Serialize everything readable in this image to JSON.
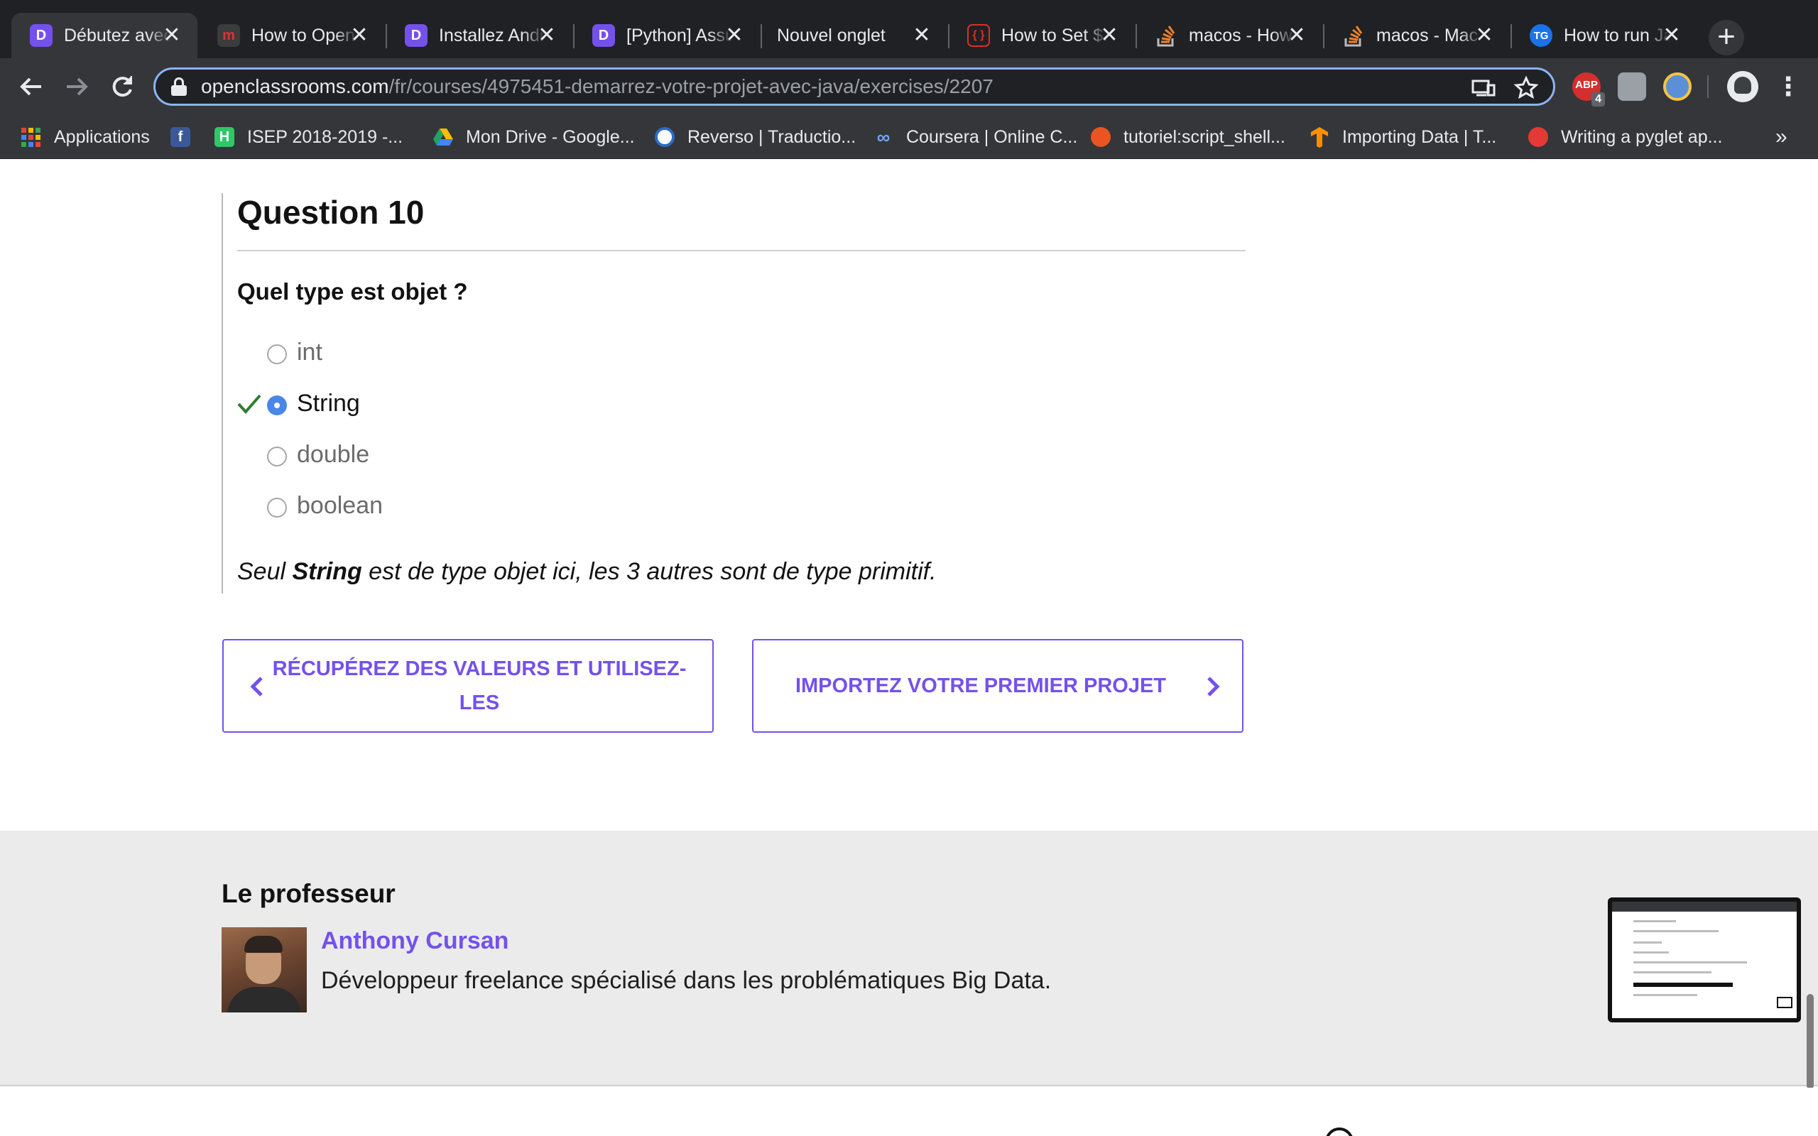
{
  "browser": {
    "tabs": [
      {
        "title": "Débutez avec Java",
        "favicon": "openclassrooms-icon",
        "favicon_color": "#7451eb",
        "active": true
      },
      {
        "title": "How to Open Terminal",
        "favicon": "m-icon",
        "favicon_color": "#d13639",
        "active": false
      },
      {
        "title": "Installez Android Studio",
        "favicon": "openclassrooms-icon",
        "favicon_color": "#7451eb",
        "active": false
      },
      {
        "title": "[Python] Assurez-vous",
        "favicon": "openclassrooms-icon",
        "favicon_color": "#7451eb",
        "active": false
      },
      {
        "title": "Nouvel onglet",
        "favicon": "",
        "favicon_color": "",
        "active": false
      },
      {
        "title": "How to Set $JAVA_HOME",
        "favicon": "code-brackets-icon",
        "favicon_color": "#d93025",
        "active": false
      },
      {
        "title": "macos - How to",
        "favicon": "stackoverflow-icon",
        "favicon_color": "#f48024",
        "active": false
      },
      {
        "title": "macos - Mac OS X",
        "favicon": "stackoverflow-icon",
        "favicon_color": "#f48024",
        "active": false
      },
      {
        "title": "How to run Java",
        "favicon": "tg-icon",
        "favicon_color": "#1a73e8",
        "active": false
      }
    ],
    "new_tab_symbol": "+",
    "close_symbol": "✕",
    "url_host": "openclassrooms.com",
    "url_path": "/fr/courses/4975451-demarrez-votre-projet-avec-java/exercises/2207",
    "extensions": {
      "adblock_label": "ABP",
      "adblock_badge": "4"
    },
    "bookmarks": [
      {
        "label": "Applications",
        "icon": "apps-grid-icon",
        "color": ""
      },
      {
        "label": "",
        "icon": "facebook-icon",
        "color": "#3b5998"
      },
      {
        "label": "ISEP 2018-2019 -...",
        "icon": "hackerrank-icon",
        "color": "#2ec866"
      },
      {
        "label": "Mon Drive - Google...",
        "icon": "google-drive-icon",
        "color": "#1fa463"
      },
      {
        "label": "Reverso | Traductio...",
        "icon": "reverso-icon",
        "color": "#2e6bc6"
      },
      {
        "label": "Coursera | Online C...",
        "icon": "coursera-icon",
        "color": "#2a73cc"
      },
      {
        "label": "tutoriel:script_shell...",
        "icon": "ubuntu-icon",
        "color": "#e95420"
      },
      {
        "label": "Importing Data  |  T...",
        "icon": "tensorflow-icon",
        "color": "#ff8f00"
      },
      {
        "label": "Writing a pyglet ap...",
        "icon": "pyglet-icon",
        "color": "#e53935"
      }
    ],
    "bookmarks_overflow": "»"
  },
  "question": {
    "title": "Question 10",
    "prompt": "Quel type est objet ?",
    "options": [
      {
        "label": "int",
        "selected": false,
        "correct": false
      },
      {
        "label": "String",
        "selected": true,
        "correct": true
      },
      {
        "label": "double",
        "selected": false,
        "correct": false
      },
      {
        "label": "boolean",
        "selected": false,
        "correct": false
      }
    ],
    "explanation_prefix": "Seul ",
    "explanation_bold": "String",
    "explanation_suffix": " est de type objet ici, les 3 autres sont de type primitif."
  },
  "navigation": {
    "prev_label_line1": "RÉCUPÉREZ DES VALEURS ET UTILISEZ-",
    "prev_label_line2": "LES",
    "next_label": "IMPORTEZ VOTRE PREMIER PROJET"
  },
  "professor": {
    "heading": "Le professeur",
    "name": "Anthony Cursan",
    "bio": "Développeur freelance spécialisé dans les problématiques Big Data."
  },
  "colors": {
    "accent": "#7451eb",
    "correct": "#2e7d32",
    "radio_selected": "#4a86e8",
    "chrome_dark": "#202124",
    "chrome_toolbar": "#35363a"
  }
}
